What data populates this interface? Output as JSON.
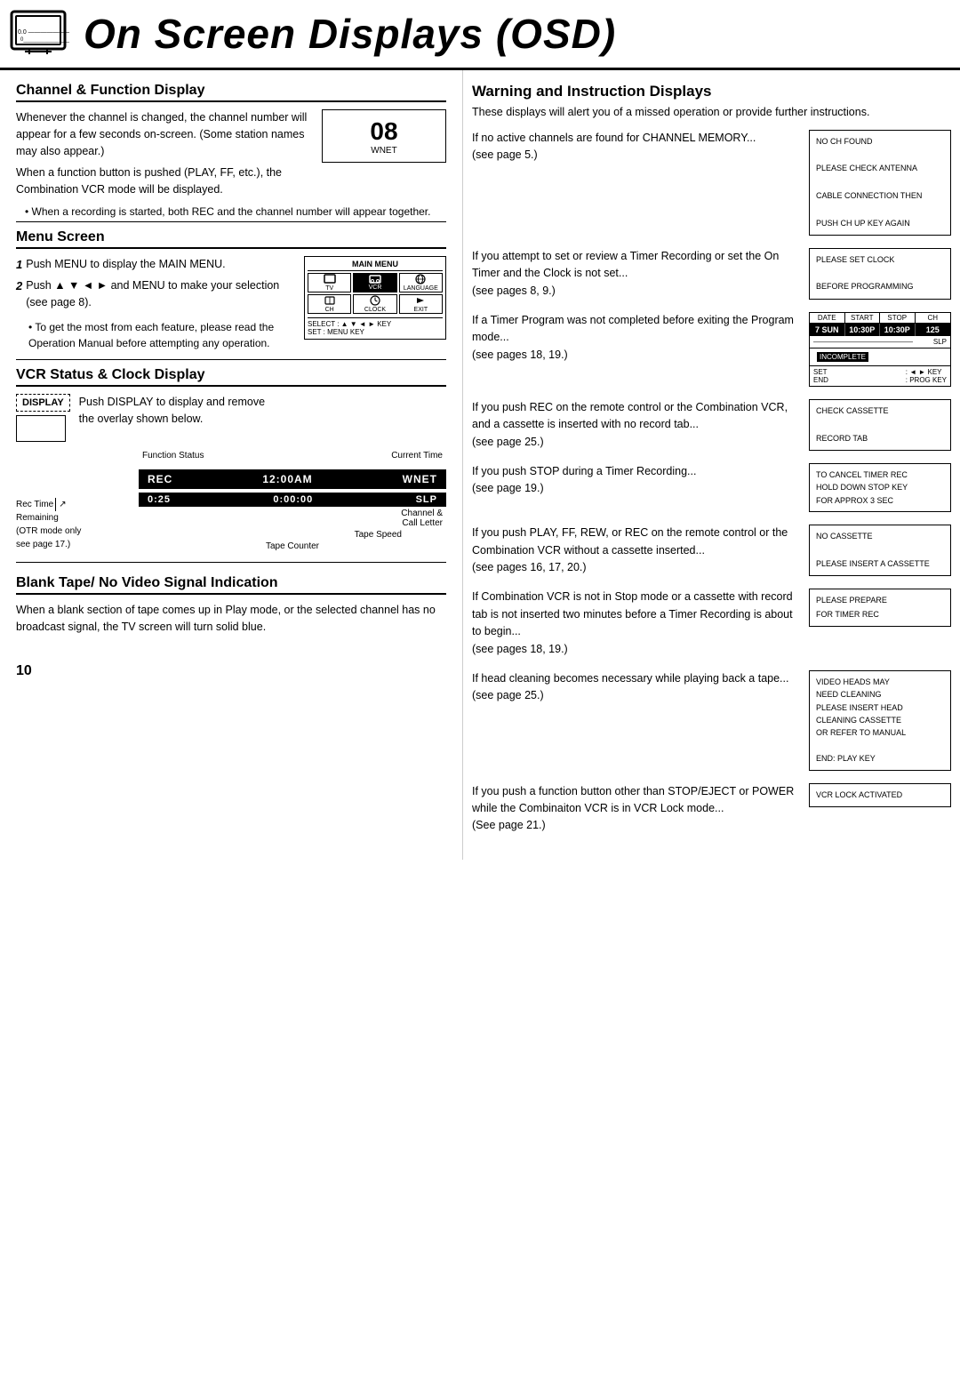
{
  "header": {
    "title": "On Screen Displays (OSD)",
    "page_number": "10"
  },
  "left": {
    "channel_section": {
      "title": "Channel & Function Display",
      "channel_number": "08",
      "channel_label": "WNET",
      "paragraphs": [
        "Whenever the channel is changed, the channel number will appear for a few seconds on-screen. (Some station names may also appear.)",
        "When a function button is pushed (PLAY, FF, etc.), the Combination VCR mode will be displayed."
      ],
      "bullet": "When a recording is started, both REC and the channel number will appear together."
    },
    "menu_section": {
      "title": "Menu Screen",
      "steps": [
        {
          "number": "1",
          "text": "Push MENU to display the MAIN MENU."
        },
        {
          "number": "2",
          "text": "Push ▲ ▼ ◄ ► and MENU to make your selection (see page 8)."
        }
      ],
      "sub_bullet": "To get the most from each feature, please read the Operation Manual before attempting any operation.",
      "main_menu_title": "MAIN MENU",
      "menu_icons": [
        {
          "label": "TV",
          "icon": "📺"
        },
        {
          "label": "VCR",
          "icon": "📼"
        },
        {
          "label": "LANGUAGE",
          "icon": "🌐"
        },
        {
          "label": "CH",
          "icon": "📡"
        },
        {
          "label": "CLOCK",
          "icon": "🕐"
        },
        {
          "label": "EXIT",
          "icon": "▶"
        }
      ],
      "select_row": "SELECT : ▲ ▼ ◄ ► KEY",
      "set_row": "SET   : MENU KEY"
    },
    "vcr_section": {
      "title": "VCR Status & Clock Display",
      "display_label": "DISPLAY",
      "display_desc_1": "Push DISPLAY to display and remove",
      "display_desc_2": "the overlay shown below.",
      "diagram": {
        "rec_label": "REC",
        "time": "12:00AM",
        "wnet": "WNET",
        "rec_time_label": "0:25",
        "time2": "0:00:00",
        "slp": "SLP",
        "left_labels": {
          "rec_time": "Rec Time",
          "remaining": "Remaining",
          "otr_note": "(OTR mode only",
          "see_page": "see page 17.)"
        },
        "right_labels": {
          "function_status": "Function Status",
          "current_time": "Current Time",
          "channel_call": "Channel &",
          "call_letter": "Call Letter"
        },
        "tape_speed": "Tape Speed",
        "tape_counter": "Tape Counter"
      }
    },
    "blank_tape_section": {
      "title": "Blank Tape/ No Video Signal Indication",
      "text": "When a blank section of tape comes up in Play mode, or the selected channel has no broadcast signal, the TV screen will turn solid blue."
    }
  },
  "right": {
    "warning_section": {
      "title": "Warning and Instruction Displays",
      "intro": "These displays will alert you of a missed operation or provide further instructions.",
      "items": [
        {
          "text": "If no active channels are found for CHANNEL MEMORY... (see page 5.)",
          "box_lines": [
            "NO CH FOUND",
            "",
            "PLEASE CHECK ANTENNA",
            "",
            "CABLE CONNECTION THEN",
            "",
            "PUSH CH UP KEY AGAIN"
          ]
        },
        {
          "text": "If you attempt to set or review a Timer Recording or set the On Timer and the Clock is not set... (see pages 8, 9.)",
          "box_lines": [
            "PLEASE SET CLOCK",
            "",
            "BEFORE PROGRAMMING"
          ],
          "inverted": false
        },
        {
          "text": "If a Timer Program was not completed before exiting the Program mode... (see pages 18, 19.)",
          "timer_box": true
        },
        {
          "text": "If you push REC on the remote control or the Combination VCR, and a cassette is inserted with no record tab... (see page 25.)",
          "box_lines": [
            "CHECK CASSETTE",
            "",
            "RECORD TAB"
          ]
        },
        {
          "text": "If you push STOP during a Timer Recording... (see page 19.)",
          "box_lines": [
            "TO CANCEL TIMER REC",
            "HOLD DOWN STOP KEY",
            "FOR APPROX 3 SEC"
          ]
        },
        {
          "text": "If you push PLAY, FF, REW, or REC on the remote control or the Combination VCR without a cassette inserted... (see pages 16, 17, 20.)",
          "box_lines": [
            "NO CASSETTE",
            "",
            "PLEASE INSERT A CASSETTE"
          ]
        },
        {
          "text": "If Combination VCR is not in Stop mode or a cassette with record tab is not inserted two minutes before a Timer Recording is about to begin... (see pages 18, 19.)",
          "box_lines": [
            "PLEASE PREPARE",
            "FOR TIMER REC"
          ]
        },
        {
          "text": "If head cleaning becomes necessary while playing back a tape... (see page 25.)",
          "box_lines": [
            "VIDEO HEADS MAY",
            "NEED CLEANING",
            "PLEASE INSERT HEAD",
            "CLEANING CASSETTE",
            "OR REFER TO MANUAL",
            "",
            "END: PLAY KEY"
          ]
        },
        {
          "text": "If you push a function button other than STOP/EJECT or POWER while the Combinaiton VCR is in VCR Lock mode... (See page 21.)",
          "box_lines": [
            "VCR LOCK ACTIVATED"
          ]
        }
      ]
    }
  }
}
